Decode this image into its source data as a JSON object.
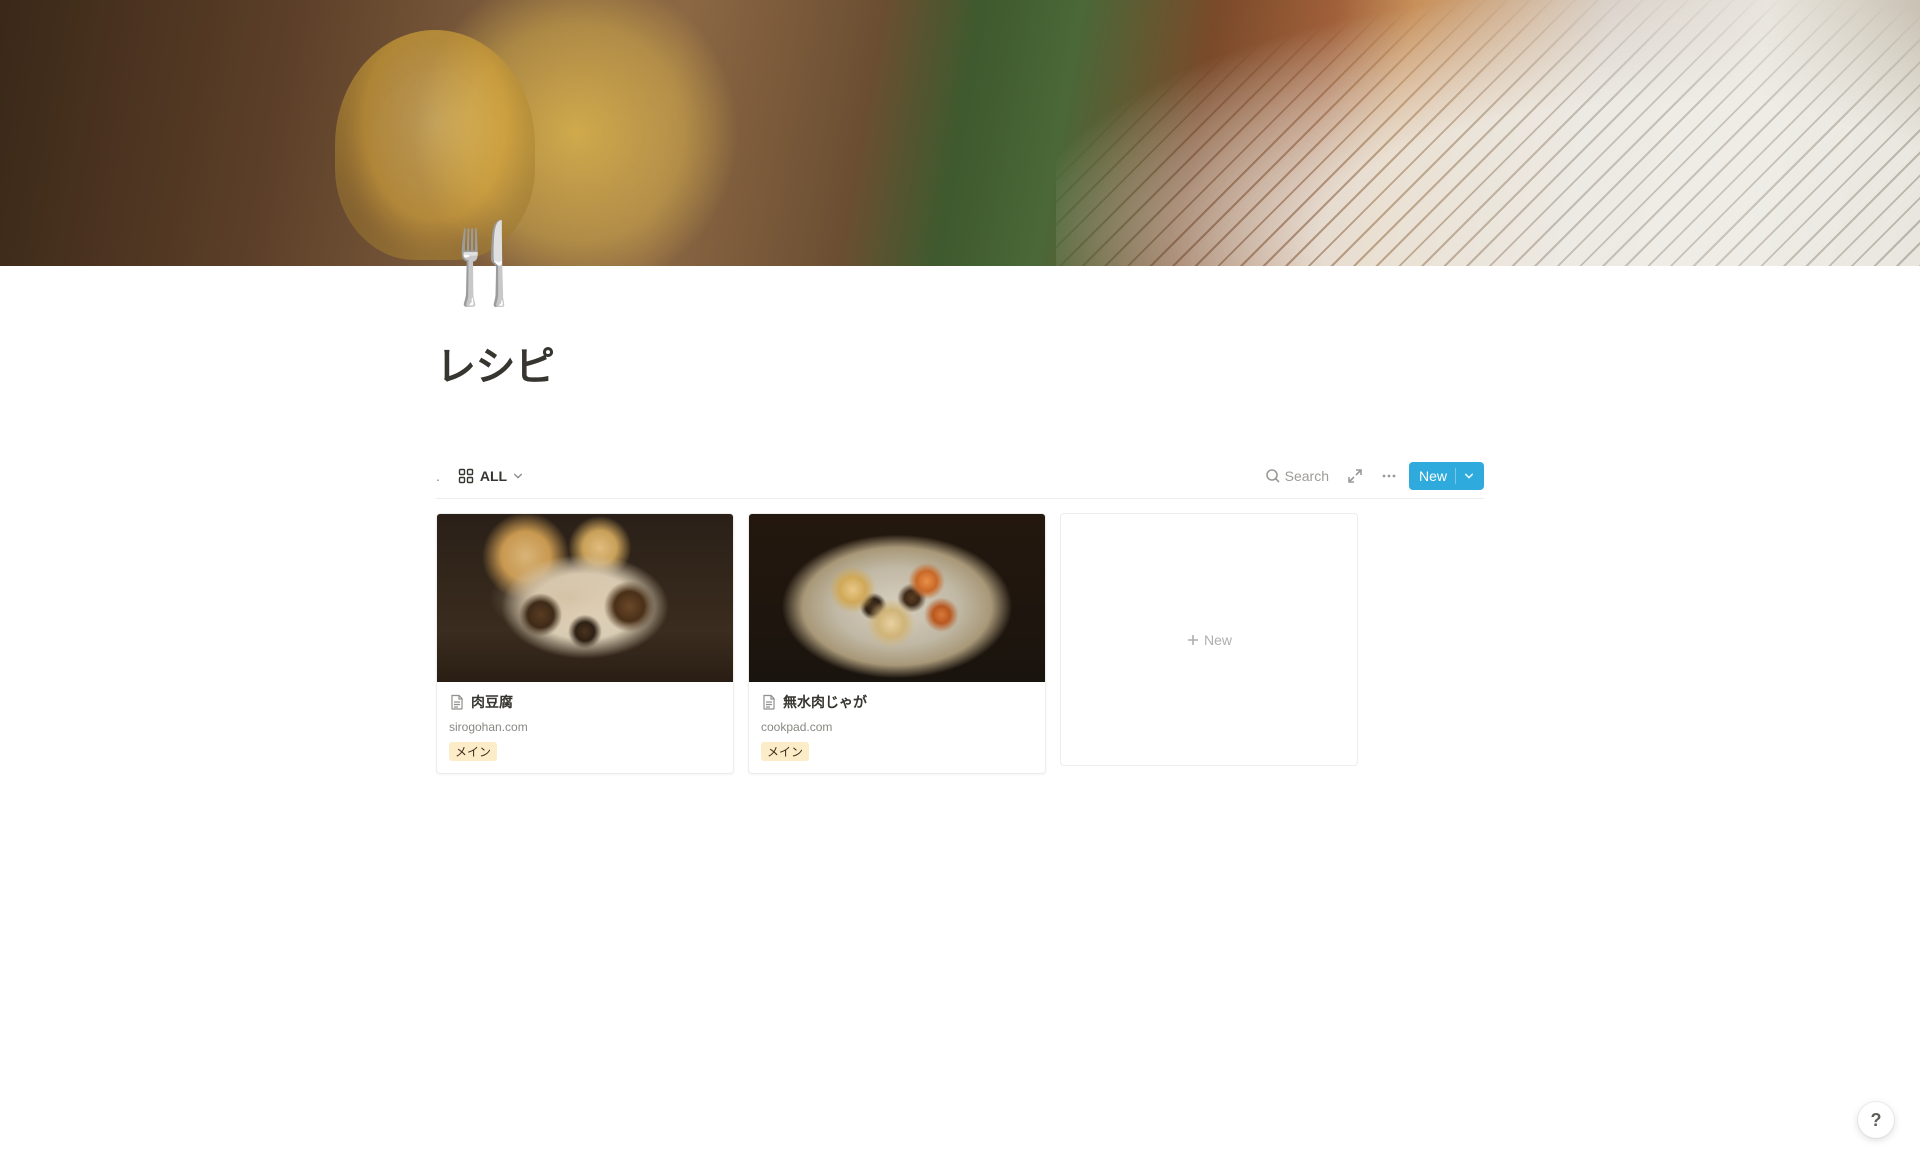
{
  "page": {
    "icon": "🍴",
    "title": "レシピ"
  },
  "toolbar": {
    "view_label": "ALL",
    "search_label": "Search",
    "new_label": "New"
  },
  "gallery": {
    "items": [
      {
        "title": "肉豆腐",
        "source": "sirogohan.com",
        "tag": "メイン"
      },
      {
        "title": "無水肉じゃが",
        "source": "cookpad.com",
        "tag": "メイン"
      }
    ],
    "new_card_label": "New"
  },
  "help": {
    "label": "?"
  }
}
